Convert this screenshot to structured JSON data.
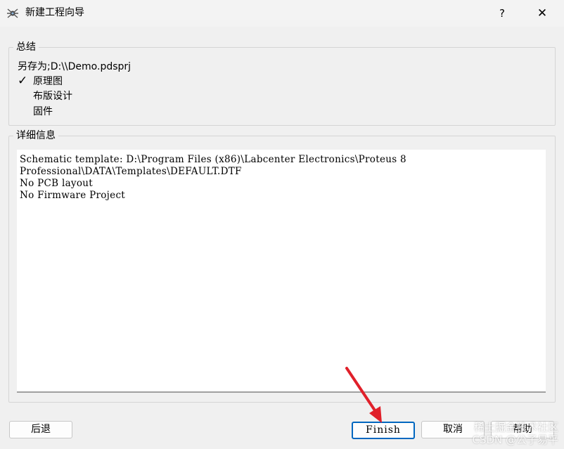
{
  "window": {
    "title": "新建工程向导",
    "help_icon": "?",
    "close_icon": "✕"
  },
  "summary": {
    "legend": "总结",
    "save_as": "另存为;D:\\\\Demo.pdsprj",
    "checkmark": "✓",
    "items": [
      {
        "label": "原理图",
        "checked": true
      },
      {
        "label": "布版设计",
        "checked": false
      },
      {
        "label": "固件",
        "checked": false
      }
    ]
  },
  "details": {
    "legend": "详细信息",
    "text": "Schematic template: D:\\Program Files (x86)\\Labcenter Electronics\\Proteus 8\nProfessional\\DATA\\Templates\\DEFAULT.DTF\nNo PCB layout\nNo Firmware Project"
  },
  "buttons": {
    "back": "后退",
    "finish": "Finish",
    "cancel": "取消",
    "help": "帮助"
  },
  "watermark": {
    "line1": "稀土掘金技术社区",
    "line2": "CSDN @公子易平"
  },
  "colors": {
    "accent": "#0067c0",
    "arrow": "#e0202a"
  }
}
